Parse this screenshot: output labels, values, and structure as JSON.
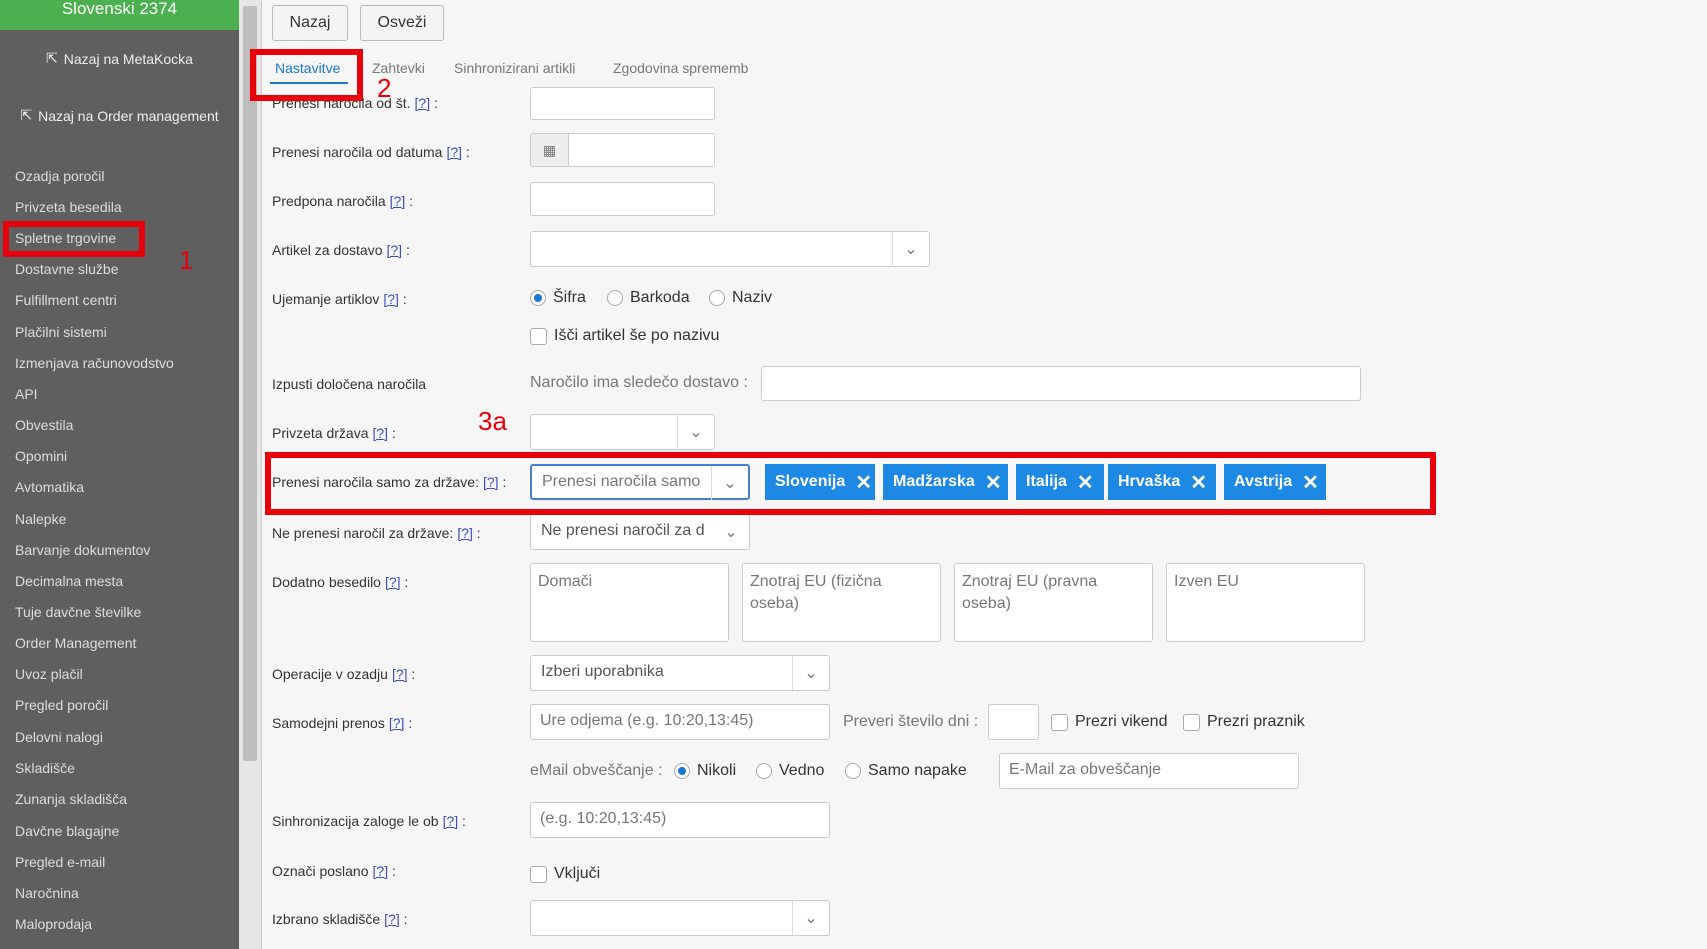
{
  "sidebar": {
    "brand": "Slovenski 2374",
    "back_metakocka": "Nazaj na MetaKocka",
    "back_order": "Nazaj na Order management",
    "items": [
      "Ozadja poročil",
      "Privzeta besedila",
      "Spletne trgovine",
      "Dostavne službe",
      "Fulfillment centri",
      "Plačilni sistemi",
      "Izmenjava računovodstvo",
      "API",
      "Obvestila",
      "Opomini",
      "Avtomatika",
      "Nalepke",
      "Barvanje dokumentov",
      "Decimalna mesta",
      "Tuje davčne številke",
      "Order Management",
      "Uvoz plačil",
      "Pregled poročil",
      "Delovni nalogi",
      "Skladišče",
      "Zunanja skladišča",
      "Davčne blagajne",
      "Pregled e-mail",
      "Naročnina",
      "Maloprodaja"
    ]
  },
  "toolbar": {
    "back": "Nazaj",
    "refresh": "Osveži"
  },
  "tabs": [
    "Nastavitve",
    "Zahtevki",
    "Sinhronizirani artikli",
    "Zgodovina sprememb"
  ],
  "help": "[?]",
  "form": {
    "prenesi_od_st": "Prenesi naročila od št.",
    "prenesi_od_datuma": "Prenesi naročila od datuma",
    "predpona": "Predpona naročila",
    "artikel_dostava": "Artikel za dostavo",
    "ujemanje": "Ujemanje artiklov",
    "ujemanje_opts": [
      "Šifra",
      "Barkoda",
      "Naziv"
    ],
    "isci_naziv": "Išči artikel še po nazivu",
    "izpusti": "Izpusti določena naročila",
    "izpusti_inline": "Naročilo ima sledečo dostavo :",
    "privzeta_drzava": "Privzeta država",
    "prenesi_samo": "Prenesi naročila samo za države:",
    "prenesi_samo_placeholder": "Prenesi naročila samo za",
    "tags": [
      "Slovenija",
      "Madžarska",
      "Italija",
      "Hrvaška",
      "Avstrija"
    ],
    "ne_prenesi": "Ne prenesi naročil za države:",
    "ne_prenesi_placeholder": "Ne prenesi naročil za d",
    "dodatno": "Dodatno besedilo",
    "dodatno_boxes": [
      "Domači",
      "Znotraj EU (fizična oseba)",
      "Znotraj EU (pravna oseba)",
      "Izven EU"
    ],
    "operacije": "Operacije v ozadju",
    "operacije_placeholder": "Izberi uporabnika",
    "samodejni": "Samodejni prenos",
    "ure_placeholder": "Ure odjema (e.g. 10:20,13:45)",
    "preveri_dni": "Preveri število dni :",
    "prezri_vikend": "Prezri vikend",
    "prezri_praznik": "Prezri praznik",
    "email_label": "eMail obveščanje :",
    "email_opts": [
      "Nikoli",
      "Vedno",
      "Samo napake"
    ],
    "email_placeholder": "E-Mail za obveščanje",
    "sinhronizacija": "Sinhronizacija zaloge le ob",
    "sinh_placeholder": "(e.g. 10:20,13:45)",
    "oznaci": "Označi poslano",
    "vkljuci": "Vključi",
    "skladisce": "Izbrano skladišče"
  },
  "annotations": [
    "1",
    "2",
    "3a"
  ],
  "colors": {
    "annotation": "#e8000b",
    "tag": "#1e88e5",
    "brand": "#4caf50",
    "sidebar": "#5f5f5f"
  }
}
